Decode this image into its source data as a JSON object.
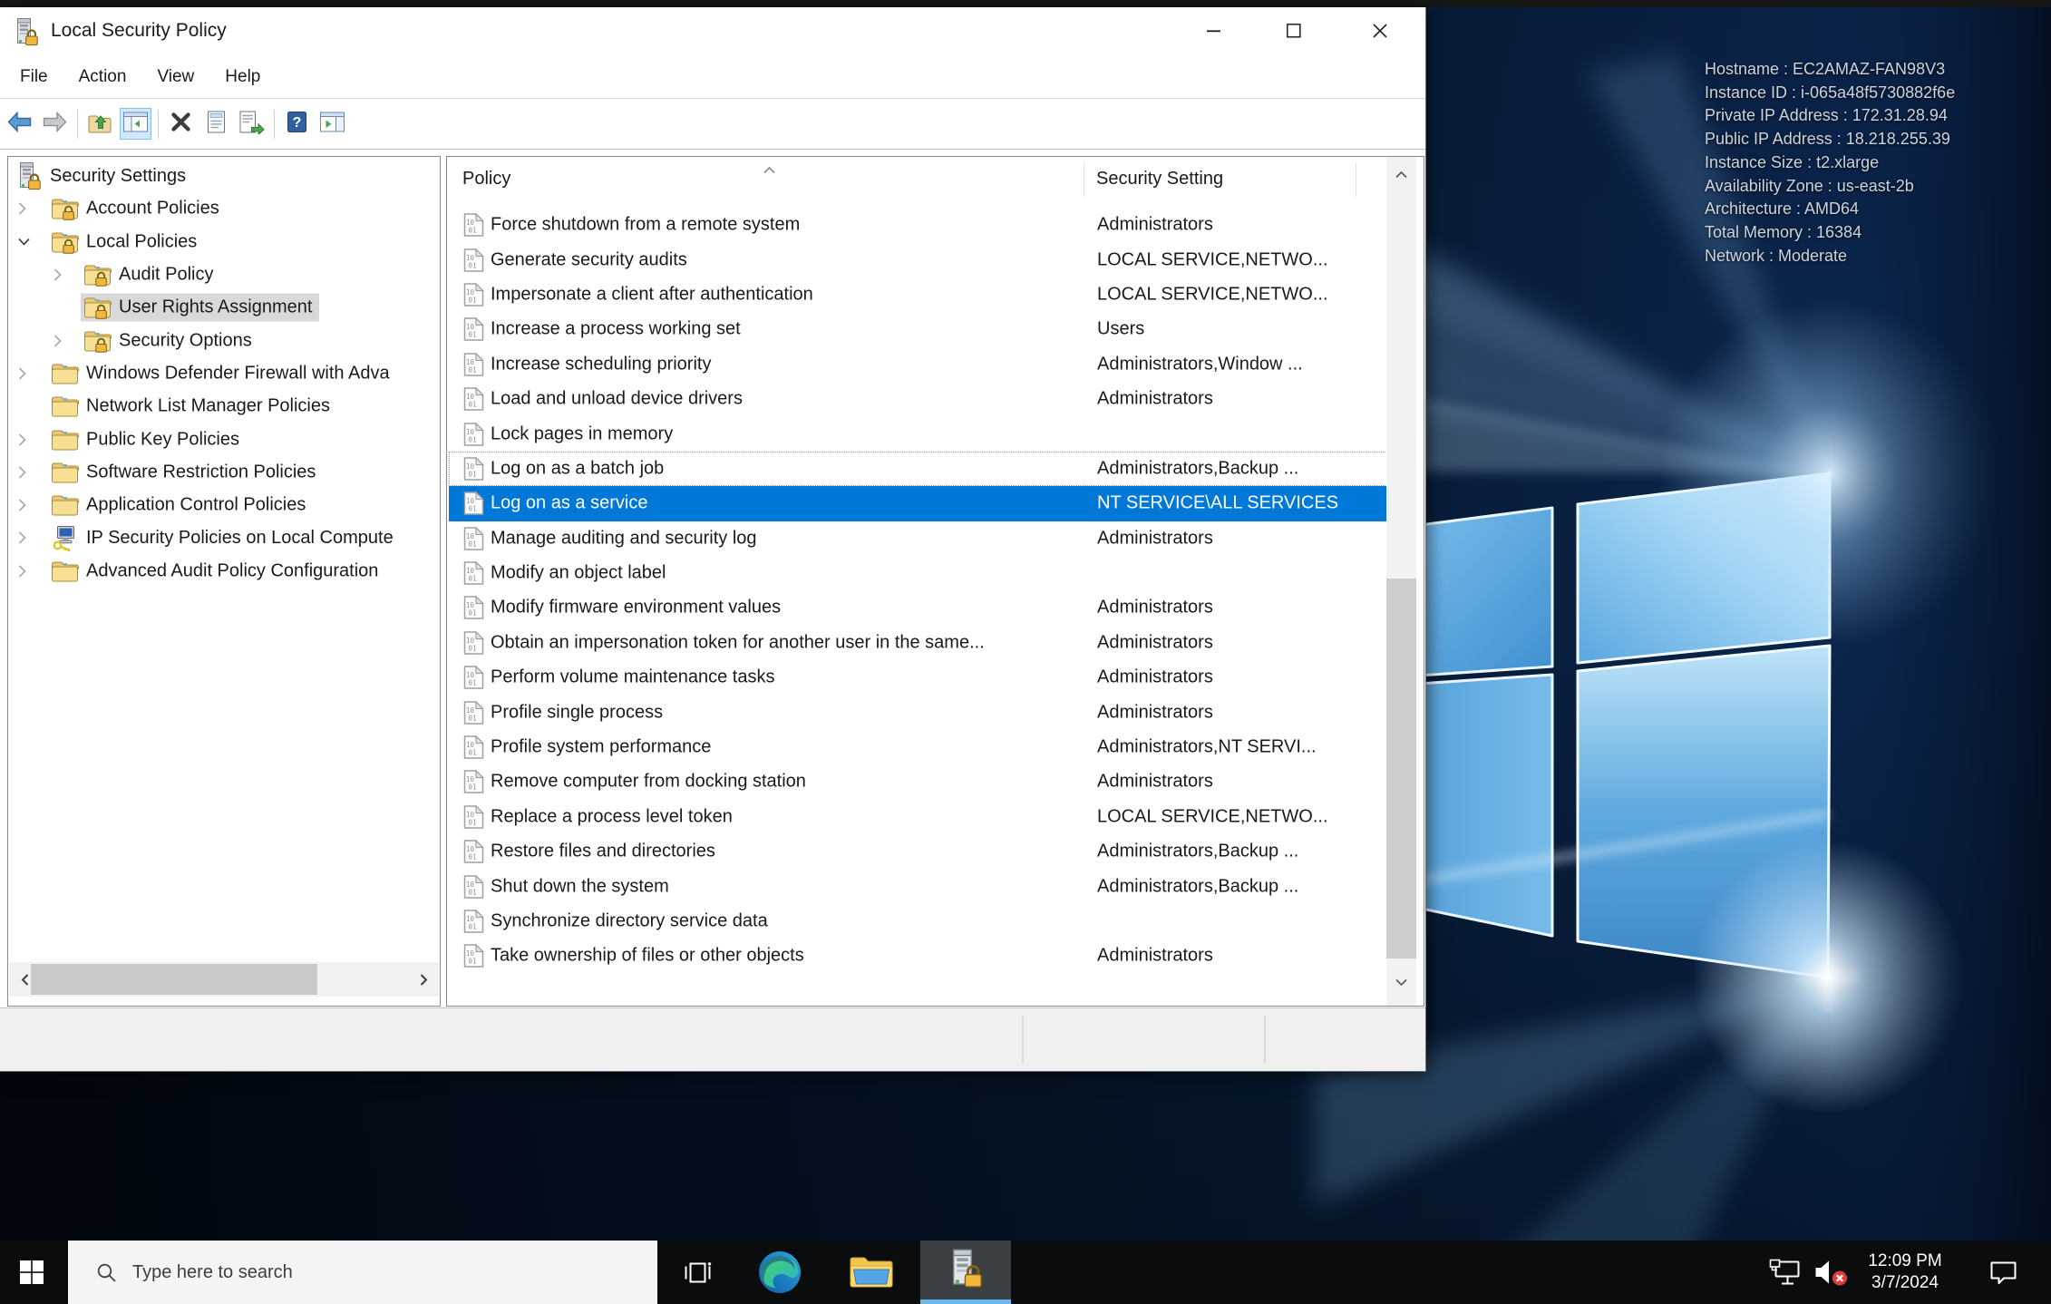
{
  "desktop": {
    "instance_info": [
      "Hostname : EC2AMAZ-FAN98V3",
      "Instance ID : i-065a48f5730882f6e",
      "Private IP Address : 172.31.28.94",
      "Public IP Address : 18.218.255.39",
      "Instance Size : t2.xlarge",
      "Availability Zone : us-east-2b",
      "Architecture : AMD64",
      "Total Memory : 16384",
      "Network : Moderate"
    ]
  },
  "window": {
    "title": "Local Security Policy",
    "menu": [
      "File",
      "Action",
      "View",
      "Help"
    ],
    "toolbar": [
      "back",
      "forward",
      "separator",
      "up-folder",
      "show-console-tree",
      "separator",
      "delete",
      "properties-list",
      "export-list",
      "separator",
      "help",
      "show-action-pane"
    ],
    "tree": [
      {
        "label": "Security Settings",
        "level": 0,
        "icon": "computer-lock",
        "arrow": null,
        "selected": false
      },
      {
        "label": "Account Policies",
        "level": 1,
        "icon": "folder-lock",
        "arrow": "collapsed",
        "selected": false
      },
      {
        "label": "Local Policies",
        "level": 1,
        "icon": "folder-lock",
        "arrow": "expanded",
        "selected": false
      },
      {
        "label": "Audit Policy",
        "level": 2,
        "icon": "folder-lock",
        "arrow": "collapsed",
        "selected": false
      },
      {
        "label": "User Rights Assignment",
        "level": 2,
        "icon": "folder-lock",
        "arrow": null,
        "selected": true
      },
      {
        "label": "Security Options",
        "level": 2,
        "icon": "folder-lock",
        "arrow": "collapsed",
        "selected": false
      },
      {
        "label": "Windows Defender Firewall with Adva",
        "level": 1,
        "icon": "folder",
        "arrow": "collapsed",
        "selected": false
      },
      {
        "label": "Network List Manager Policies",
        "level": 1,
        "icon": "folder",
        "arrow": null,
        "selected": false
      },
      {
        "label": "Public Key Policies",
        "level": 1,
        "icon": "folder",
        "arrow": "collapsed",
        "selected": false
      },
      {
        "label": "Software Restriction Policies",
        "level": 1,
        "icon": "folder",
        "arrow": "collapsed",
        "selected": false
      },
      {
        "label": "Application Control Policies",
        "level": 1,
        "icon": "folder",
        "arrow": "collapsed",
        "selected": false
      },
      {
        "label": "IP Security Policies on Local Compute",
        "level": 1,
        "icon": "computer-key",
        "arrow": "collapsed",
        "selected": false
      },
      {
        "label": "Advanced Audit Policy Configuration",
        "level": 1,
        "icon": "folder",
        "arrow": "collapsed",
        "selected": false
      }
    ],
    "list": {
      "columns": [
        "Policy",
        "Security Setting"
      ],
      "sort": "ascending",
      "rows": [
        {
          "policy": "Force shutdown from a remote system",
          "setting": "Administrators"
        },
        {
          "policy": "Generate security audits",
          "setting": "LOCAL SERVICE,NETWO..."
        },
        {
          "policy": "Impersonate a client after authentication",
          "setting": "LOCAL SERVICE,NETWO..."
        },
        {
          "policy": "Increase a process working set",
          "setting": "Users"
        },
        {
          "policy": "Increase scheduling priority",
          "setting": "Administrators,Window ..."
        },
        {
          "policy": "Load and unload device drivers",
          "setting": "Administrators"
        },
        {
          "policy": "Lock pages in memory",
          "setting": ""
        },
        {
          "policy": "Log on as a batch job",
          "setting": "Administrators,Backup ...",
          "focused": true
        },
        {
          "policy": "Log on as a service",
          "setting": "NT SERVICE\\ALL SERVICES",
          "selected": true
        },
        {
          "policy": "Manage auditing and security log",
          "setting": "Administrators"
        },
        {
          "policy": "Modify an object label",
          "setting": ""
        },
        {
          "policy": "Modify firmware environment values",
          "setting": "Administrators"
        },
        {
          "policy": "Obtain an impersonation token for another user in the same...",
          "setting": "Administrators"
        },
        {
          "policy": "Perform volume maintenance tasks",
          "setting": "Administrators"
        },
        {
          "policy": "Profile single process",
          "setting": "Administrators"
        },
        {
          "policy": "Profile system performance",
          "setting": "Administrators,NT SERVI..."
        },
        {
          "policy": "Remove computer from docking station",
          "setting": "Administrators"
        },
        {
          "policy": "Replace a process level token",
          "setting": "LOCAL SERVICE,NETWO..."
        },
        {
          "policy": "Restore files and directories",
          "setting": "Administrators,Backup ..."
        },
        {
          "policy": "Shut down the system",
          "setting": "Administrators,Backup ..."
        },
        {
          "policy": "Synchronize directory service data",
          "setting": ""
        },
        {
          "policy": "Take ownership of files or other objects",
          "setting": "Administrators"
        }
      ]
    }
  },
  "taskbar": {
    "search_placeholder": "Type here to search",
    "time": "12:09 PM",
    "date": "3/7/2024",
    "pinned_icons": [
      "start",
      "task-view",
      "edge",
      "file-explorer",
      "local-security-policy"
    ],
    "tray_icons": [
      "network",
      "volume-muted",
      "clock",
      "action-center"
    ]
  },
  "colors": {
    "selection_blue": "#0078d7",
    "tree_selection_gray": "#d9d9d9",
    "taskbar_active_underline": "#6cb8e8",
    "status_bar_gray": "#f0f0f0"
  }
}
